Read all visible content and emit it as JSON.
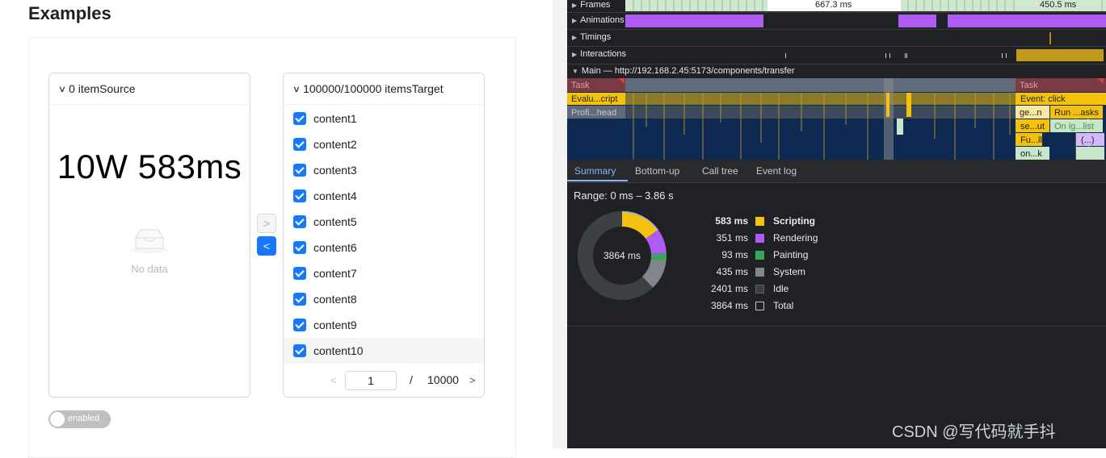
{
  "left": {
    "title": "Examples",
    "source": {
      "header": "0 itemSource",
      "big_text": "10W 583ms",
      "empty_text": "No data"
    },
    "target": {
      "header": "100000/100000 itemsTarget",
      "items": [
        "content1",
        "content2",
        "content3",
        "content4",
        "content5",
        "content6",
        "content7",
        "content8",
        "content9",
        "content10"
      ],
      "page_current": "1",
      "page_slash": "/",
      "page_total": "10000"
    },
    "toggle_label": "enabled"
  },
  "devtools": {
    "tracks": {
      "frames": "Frames",
      "frame_time_1": "667.3 ms",
      "frame_time_2": "450.5 ms",
      "animations": "Animations",
      "timings": "Timings",
      "interactions": "Interactions",
      "main": "Main — http://192.168.2.45:5173/components/transfer"
    },
    "flame": {
      "task_1": "Task",
      "task_2": "Task",
      "eval_script": "Evalu...cript",
      "event_click": "Event: click",
      "profile_head": "Profi...head",
      "ge_n": "ge...n",
      "run_tasks": "Run ...asks",
      "se_ut": "se...ut",
      "on_ig_list": "On ig...list",
      "fu_ll": "Fu...ll",
      "anon": "(...)",
      "on_k": "on...k"
    },
    "tabs": [
      "Summary",
      "Bottom-up",
      "Call tree",
      "Event log"
    ],
    "range": "Range: 0 ms – 3.86 s",
    "donut_center": "3864 ms",
    "summary": [
      {
        "value": "583 ms",
        "name": "Scripting",
        "color": "#f4c20d"
      },
      {
        "value": "351 ms",
        "name": "Rendering",
        "color": "#af5cf7"
      },
      {
        "value": "93 ms",
        "name": "Painting",
        "color": "#34a853"
      },
      {
        "value": "435 ms",
        "name": "System",
        "color": "#80868b"
      },
      {
        "value": "2401 ms",
        "name": "Idle",
        "color": "#3c4043"
      },
      {
        "value": "3864 ms",
        "name": "Total",
        "color": "#202124"
      }
    ]
  },
  "watermark": "CSDN @写代码就手抖"
}
